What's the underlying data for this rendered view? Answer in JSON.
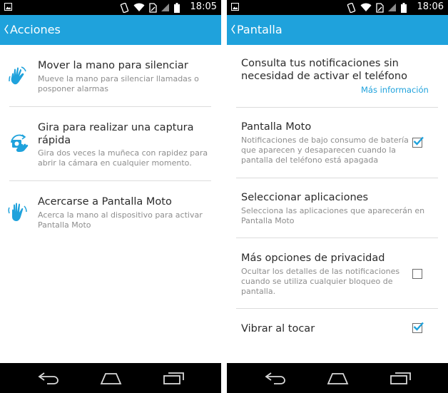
{
  "left_screen": {
    "status": {
      "time": "18:05"
    },
    "actionbar": {
      "title": "Acciones"
    },
    "items": [
      {
        "title": "Mover la mano para silenciar",
        "subtitle": "Mueve la mano para silenciar llamadas o\nposponer alarmas",
        "icon": "wave-hand-icon"
      },
      {
        "title": "Gira para realizar una captura\nrápida",
        "subtitle": "Gira dos veces la muñeca con rapidez para\nabrir la cámara en cualquier momento.",
        "icon": "twist-camera-icon"
      },
      {
        "title": "Acercarse a Pantalla Moto",
        "subtitle": "Acerca la mano al dispositivo para activar\nPantalla Moto",
        "icon": "approach-hand-icon"
      }
    ]
  },
  "right_screen": {
    "status": {
      "time": "18:06"
    },
    "actionbar": {
      "title": "Pantalla"
    },
    "header": {
      "text": "Consulta tus notificaciones sin\nnecesidad de activar el teléfono",
      "link": "Más información"
    },
    "items": [
      {
        "title": "Pantalla Moto",
        "subtitle": "Notificaciones de bajo consumo de batería\nque aparecen y desaparecen cuando la\npantalla del teléfono está apagada",
        "checked": true
      },
      {
        "title": "Seleccionar aplicaciones",
        "subtitle": "Selecciona las aplicaciones que aparecerán en\nPantalla Moto"
      },
      {
        "title": "Más opciones de privacidad",
        "subtitle": "Ocultar los detalles de las notificaciones\ncuando se utiliza cualquier bloqueo de\npantalla.",
        "checked": false
      },
      {
        "title": "Vibrar al tocar",
        "checked": true
      }
    ]
  },
  "colors": {
    "accent": "#1fa2dc",
    "statusbar": "#000000",
    "title_text": "#2b2b2b",
    "subtitle_text": "#8d8d8d",
    "divider": "#dcdcdc"
  }
}
